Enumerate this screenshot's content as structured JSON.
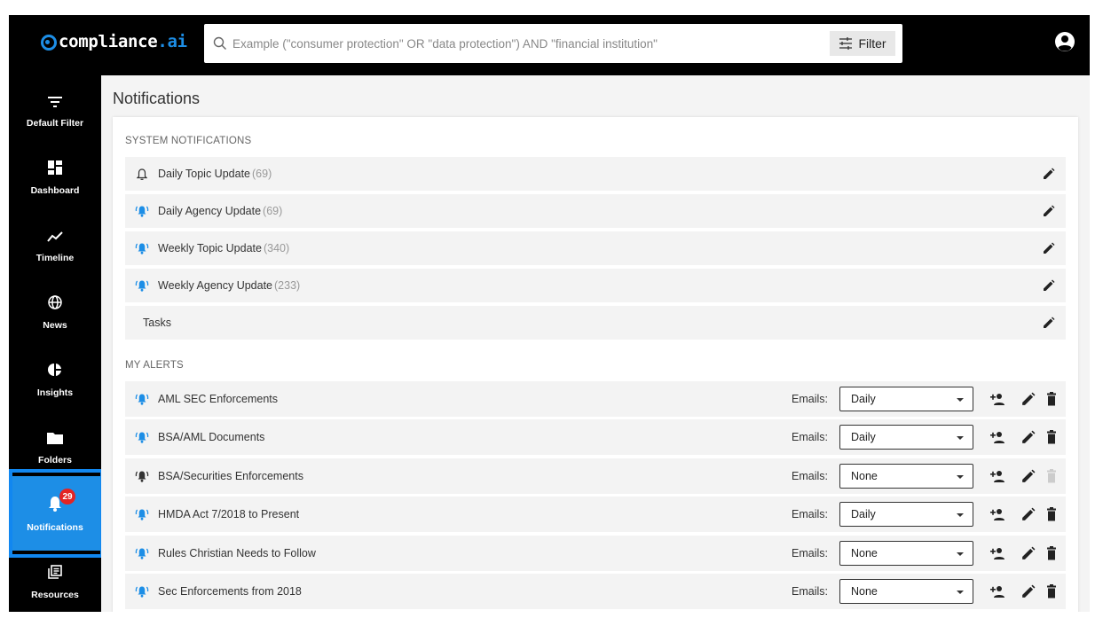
{
  "app": {
    "logo_text_main": "compliance",
    "logo_text_suffix": ".ai"
  },
  "search": {
    "placeholder": "Example (\"consumer protection\" OR \"data protection\") AND \"financial institution\"",
    "value": ""
  },
  "filter_button": {
    "label": "Filter"
  },
  "sidebar": {
    "items": [
      {
        "label": "Default Filter",
        "icon": "filter-icon"
      },
      {
        "label": "Dashboard",
        "icon": "dashboard-icon"
      },
      {
        "label": "Timeline",
        "icon": "timeline-icon"
      },
      {
        "label": "News",
        "icon": "globe-icon"
      },
      {
        "label": "Insights",
        "icon": "pie-chart-icon"
      },
      {
        "label": "Folders",
        "icon": "folder-icon"
      },
      {
        "label": "Notifications",
        "icon": "bell-icon",
        "badge": "29",
        "active": true
      },
      {
        "label": "Resources",
        "icon": "resources-icon"
      }
    ]
  },
  "page": {
    "title": "Notifications"
  },
  "system_notifications": {
    "heading": "SYSTEM NOTIFICATIONS",
    "items": [
      {
        "name": "Daily Topic Update",
        "count": "(69)",
        "icon": "bell-outline-icon"
      },
      {
        "name": "Daily Agency Update",
        "count": "(69)",
        "icon": "bell-ringing-icon"
      },
      {
        "name": "Weekly Topic Update",
        "count": "(340)",
        "icon": "bell-ringing-icon"
      },
      {
        "name": "Weekly Agency Update",
        "count": "(233)",
        "icon": "bell-ringing-icon"
      },
      {
        "name": "Tasks",
        "count": "",
        "icon": ""
      }
    ]
  },
  "my_alerts": {
    "heading": "MY ALERTS",
    "emails_label": "Emails:",
    "items": [
      {
        "name": "AML SEC Enforcements",
        "frequency": "Daily",
        "bell_color": "#1d8ee6"
      },
      {
        "name": "BSA/AML Documents",
        "frequency": "Daily",
        "bell_color": "#1d8ee6"
      },
      {
        "name": "BSA/Securities Enforcements",
        "frequency": "None",
        "bell_color": "#333333",
        "delete_disabled": true
      },
      {
        "name": "HMDA Act 7/2018 to Present",
        "frequency": "Daily",
        "bell_color": "#1d8ee6"
      },
      {
        "name": "Rules Christian Needs to Follow",
        "frequency": "None",
        "bell_color": "#1d8ee6"
      },
      {
        "name": "Sec Enforcements from 2018",
        "frequency": "None",
        "bell_color": "#1d8ee6"
      }
    ]
  },
  "colors": {
    "accent": "#1d8ee6",
    "badge": "#e32424",
    "topbar": "#000000"
  }
}
